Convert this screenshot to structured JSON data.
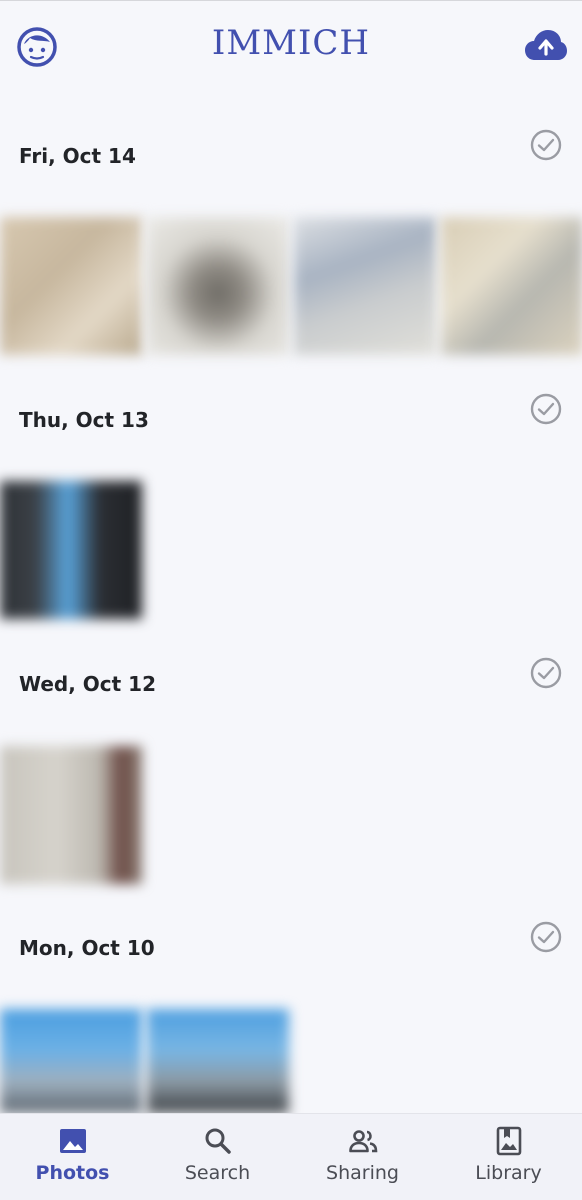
{
  "header": {
    "app_name": "IMMICH",
    "avatar_icon": "face-icon",
    "upload_icon": "cloud-upload-icon"
  },
  "colors": {
    "accent": "#4250af",
    "background": "#f6f7fb",
    "check": "#9a9ca3"
  },
  "groups": [
    {
      "date": "Fri, Oct 14"
    },
    {
      "date": "Thu, Oct 13"
    },
    {
      "date": "Wed, Oct 12"
    },
    {
      "date": "Mon, Oct 10"
    }
  ],
  "nav": {
    "items": [
      {
        "label": "Photos",
        "icon": "photo-icon",
        "active": true
      },
      {
        "label": "Search",
        "icon": "search-icon",
        "active": false
      },
      {
        "label": "Sharing",
        "icon": "people-icon",
        "active": false
      },
      {
        "label": "Library",
        "icon": "library-icon",
        "active": false
      }
    ]
  }
}
